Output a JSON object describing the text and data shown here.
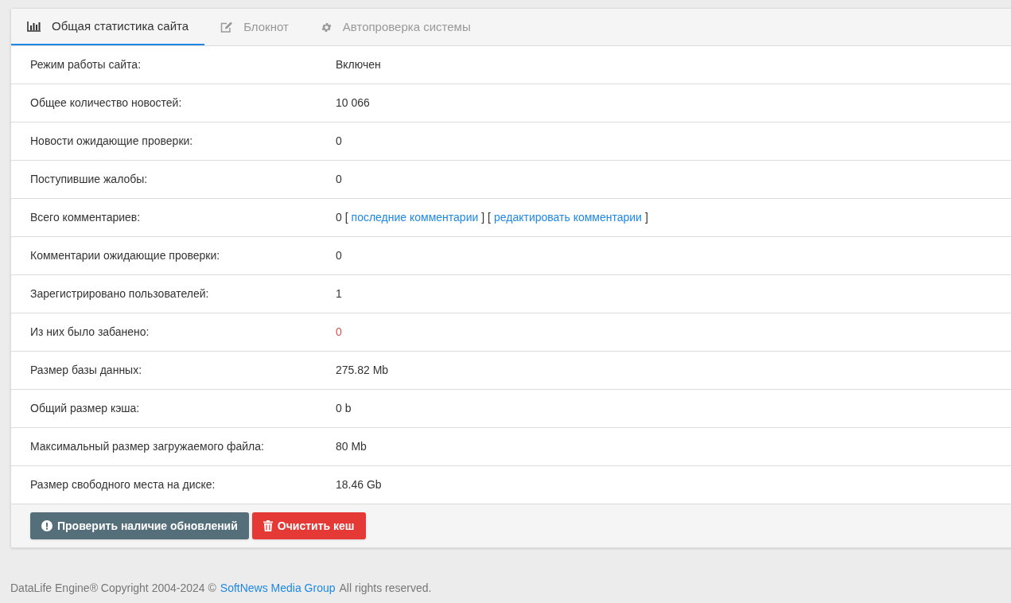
{
  "tabs": [
    {
      "label": "Общая статистика сайта",
      "kind": "chart",
      "selected": true
    },
    {
      "label": "Блокнот",
      "kind": "edit",
      "selected": false
    },
    {
      "label": "Автопроверка системы",
      "kind": "gear",
      "selected": false
    }
  ],
  "rows": [
    {
      "label": "Режим работы сайта:",
      "value": [
        {
          "kind": "text",
          "text": "Включен"
        }
      ]
    },
    {
      "label": "Общее количество новостей:",
      "value": [
        {
          "kind": "text",
          "text": "10 066"
        }
      ]
    },
    {
      "label": "Новости ожидающие проверки:",
      "value": [
        {
          "kind": "text",
          "text": "0"
        }
      ]
    },
    {
      "label": "Поступившие жалобы:",
      "value": [
        {
          "kind": "text",
          "text": "0"
        }
      ]
    },
    {
      "label": "Всего комментариев:",
      "value": [
        {
          "kind": "text",
          "text": "0 ["
        },
        {
          "kind": "link",
          "text": "последние комментарии"
        },
        {
          "kind": "text",
          "text": "] ["
        },
        {
          "kind": "link",
          "text": "редактировать комментарии"
        },
        {
          "kind": "text",
          "text": "]"
        }
      ]
    },
    {
      "label": "Комментарии ожидающие проверки:",
      "value": [
        {
          "kind": "text",
          "text": "0"
        }
      ]
    },
    {
      "label": "Зарегистрировано пользователей:",
      "value": [
        {
          "kind": "text",
          "text": "1"
        }
      ]
    },
    {
      "label": "Из них было забанено:",
      "value": [
        {
          "kind": "warning",
          "text": "0"
        }
      ]
    },
    {
      "label": "Размер базы данных:",
      "value": [
        {
          "kind": "text",
          "text": "275.82 Mb"
        }
      ]
    },
    {
      "label": "Общий размер кэша:",
      "value": [
        {
          "kind": "text",
          "text": "0 b"
        }
      ]
    },
    {
      "label": "Максимальный размер загружаемого файла:",
      "value": [
        {
          "kind": "text",
          "text": "80 Mb"
        }
      ]
    },
    {
      "label": "Размер свободного места на диске:",
      "value": [
        {
          "kind": "text",
          "text": "18.46 Gb"
        }
      ]
    }
  ],
  "buttons": [
    {
      "kind": "check",
      "label": "Проверить наличие обновлений"
    },
    {
      "kind": "clear",
      "label": "Очистить кеш"
    }
  ],
  "footer": {
    "before": "DataLife Engine® Copyright 2004-2024 ©",
    "link": "SoftNews Media Group",
    "after": "All rights reserved."
  }
}
